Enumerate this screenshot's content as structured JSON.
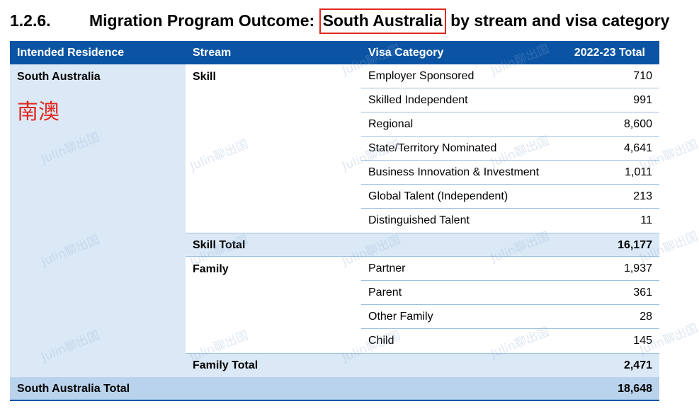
{
  "heading": {
    "number": "1.2.6.",
    "title_prefix": "Migration Program Outcome: ",
    "title_highlight": "South Australia",
    "title_suffix": " by stream and visa category"
  },
  "table": {
    "headers": [
      "Intended Residence",
      "Stream",
      "Visa Category",
      "2022-23 Total"
    ],
    "residence": "South Australia",
    "residence_note": "南澳",
    "skill": {
      "name": "Skill",
      "rows": [
        {
          "category": "Employer Sponsored",
          "value": "710"
        },
        {
          "category": "Skilled Independent",
          "value": "991"
        },
        {
          "category": "Regional",
          "value": "8,600"
        },
        {
          "category": "State/Territory Nominated",
          "value": "4,641"
        },
        {
          "category": "Business Innovation & Investment",
          "value": "1,011"
        },
        {
          "category": "Global Talent (Independent)",
          "value": "213"
        },
        {
          "category": "Distinguished Talent",
          "value": "11"
        }
      ],
      "total_label": "Skill Total",
      "total_value": "16,177"
    },
    "family": {
      "name": "Family",
      "rows": [
        {
          "category": "Partner",
          "value": "1,937"
        },
        {
          "category": "Parent",
          "value": "361"
        },
        {
          "category": "Other Family",
          "value": "28"
        },
        {
          "category": "Child",
          "value": "145"
        }
      ],
      "total_label": "Family Total",
      "total_value": "2,471"
    },
    "grand_total_label": "South Australia Total",
    "grand_total_value": "18,648"
  },
  "watermark": "Julin聊出国"
}
